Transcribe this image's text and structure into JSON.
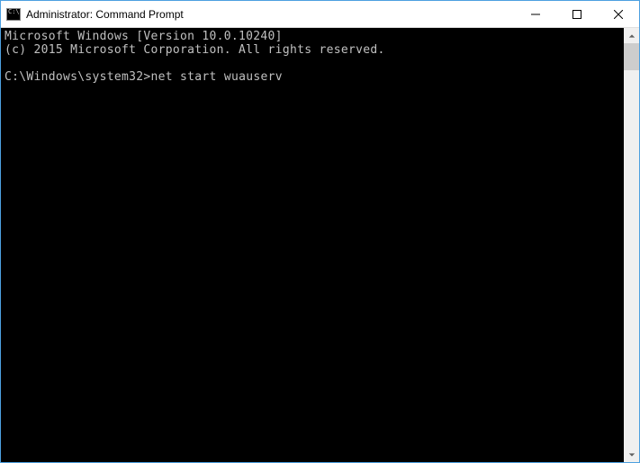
{
  "window": {
    "title": "Administrator: Command Prompt"
  },
  "terminal": {
    "line1": "Microsoft Windows [Version 10.0.10240]",
    "line2": "(c) 2015 Microsoft Corporation. All rights reserved.",
    "prompt": "C:\\Windows\\system32>",
    "command": "net start wuauserv"
  }
}
